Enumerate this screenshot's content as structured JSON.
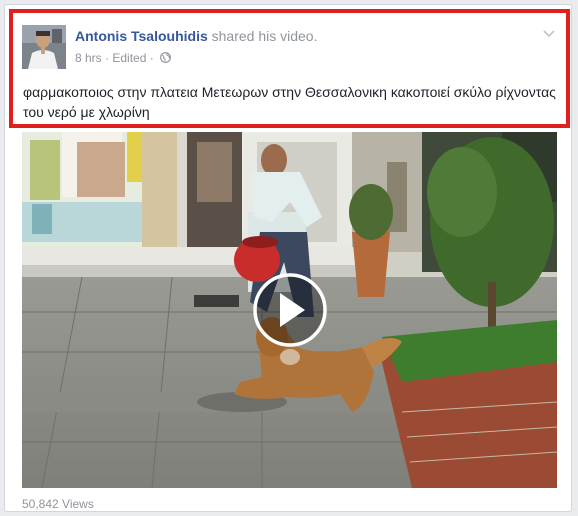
{
  "post": {
    "author": "Antonis Tsalouhidis",
    "action_text": "shared his",
    "link_text": "video",
    "punct": ".",
    "time": "8 hrs",
    "separator": "·",
    "edited": "Edited",
    "separator2": "·",
    "audience_icon": "globe-icon",
    "menu_icon": "chevron-down-icon",
    "text": "φαρμακοποιος στην πλατεια Μετεωρων στην Θεσσαλονικη κακοποιεί σκύλο ρίχνοντας του νερό με χλωρίνη"
  },
  "video": {
    "play_icon": "play-icon",
    "views": "50,842 Views"
  },
  "colors": {
    "highlight_border": "#e0201f",
    "author_link": "#365899",
    "meta_gray": "#90949c",
    "body_text": "#1d2129"
  }
}
